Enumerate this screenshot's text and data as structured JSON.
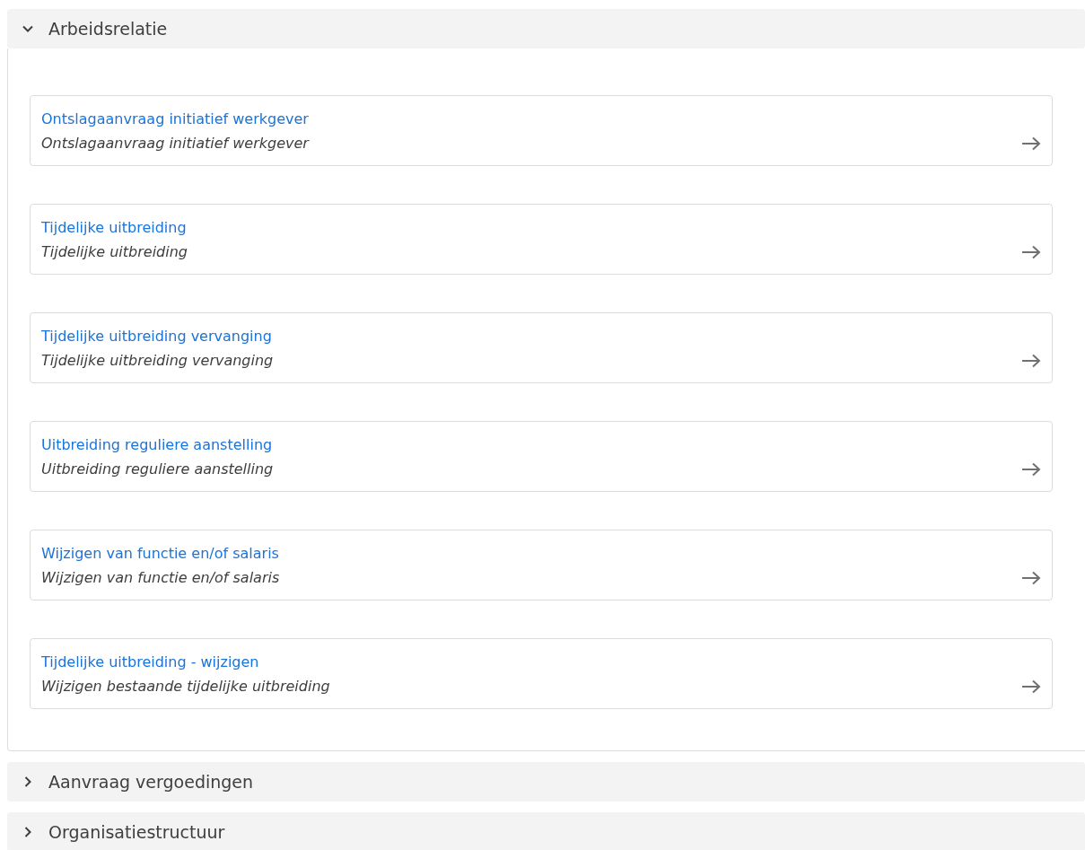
{
  "sections": [
    {
      "title": "Arbeidsrelatie",
      "expanded": true,
      "items": [
        {
          "title": "Ontslagaanvraag initiatief werkgever",
          "description": "Ontslagaanvraag initiatief werkgever"
        },
        {
          "title": "Tijdelijke uitbreiding",
          "description": "Tijdelijke uitbreiding"
        },
        {
          "title": "Tijdelijke uitbreiding vervanging",
          "description": "Tijdelijke uitbreiding vervanging"
        },
        {
          "title": "Uitbreiding reguliere aanstelling",
          "description": "Uitbreiding reguliere aanstelling"
        },
        {
          "title": "Wijzigen van functie en/of salaris",
          "description": "Wijzigen van functie en/of salaris"
        },
        {
          "title": "Tijdelijke uitbreiding - wijzigen",
          "description": "Wijzigen bestaande tijdelijke uitbreiding"
        }
      ]
    },
    {
      "title": "Aanvraag vergoedingen",
      "expanded": false
    },
    {
      "title": "Organisatiestructuur",
      "expanded": false
    }
  ]
}
